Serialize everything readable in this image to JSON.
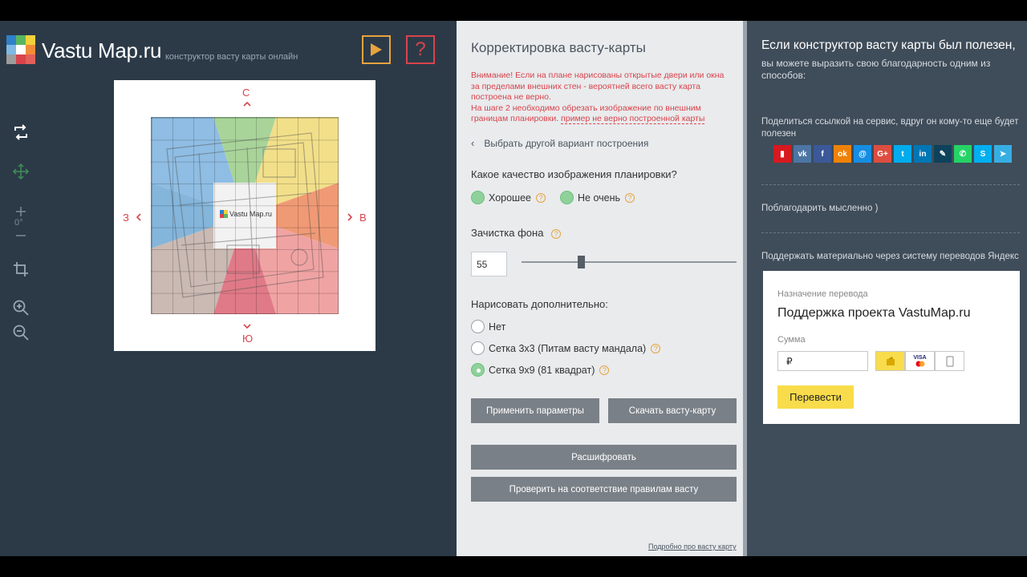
{
  "app": {
    "brand": "Vastu Map.ru",
    "tagline": "конструктор васту карты онлайн",
    "colors": {
      "play": "#e8a33d",
      "help": "#d9434b",
      "accent_green": "#8fd19b",
      "yandex_yellow": "#f8dc4b"
    }
  },
  "toolbar": {
    "help_label": "?",
    "rotation_label": "0°"
  },
  "map": {
    "north": "С",
    "south": "Ю",
    "west": "З",
    "east": "В",
    "center_logo": "Vastu Map.ru"
  },
  "panel": {
    "title": "Корректировка васту-карты",
    "warning_lines": [
      "Внимание! Если на плане нарисованы открытые двери или окна",
      "за пределами внешних стен - вероятней всего васту карта",
      "построена не верно.",
      "На шаге 2 необходимо обрезать изображение по внешним",
      "границам планировки."
    ],
    "warning_link": "пример не верно построенной карты",
    "back_label": "Выбрать другой вариант построения",
    "quality_question": "Какое качество изображения планировки?",
    "quality_options": [
      "Хорошее",
      "Не очень"
    ],
    "bg_cleanup_label": "Зачистка фона",
    "bg_cleanup_value": "55",
    "bg_cleanup_slider": 0.27,
    "draw_label": "Нарисовать дополнительно:",
    "draw_options": [
      "Нет",
      "Сетка 3х3 (Питам васту мандала)",
      "Сетка 9х9 (81 квадрат)"
    ],
    "draw_selected": "Сетка 9х9 (81 квадрат)",
    "btn_apply": "Применить параметры",
    "btn_download": "Скачать васту-карту",
    "btn_decode": "Расшифровать",
    "btn_check": "Проверить на соответствие правилам васту",
    "footer_link": "Подробно про васту карту"
  },
  "donate": {
    "heading": "Если конструктор васту карты был полезен,",
    "subheading": "вы можете выразить свою благодарность одним из способов:",
    "share_text": "Поделиться ссылкой на сервис, вдруг он кому-то еще будет полезен",
    "socials": [
      "bookmark",
      "vk",
      "facebook",
      "odnoklassniki",
      "moimir",
      "google-plus",
      "twitter",
      "linkedin",
      "livejournal",
      "whatsapp",
      "skype",
      "telegram"
    ],
    "thanks_text": "Поблагодарить мысленно )",
    "yandex_text": "Поддержать материально через систему переводов Яндекс",
    "form": {
      "purpose_label": "Назначение перевода",
      "purpose_value": "Поддержка проекта VastuMap.ru",
      "amount_label": "Сумма",
      "currency": "₽",
      "card_label": "VISA",
      "submit": "Перевести"
    }
  }
}
